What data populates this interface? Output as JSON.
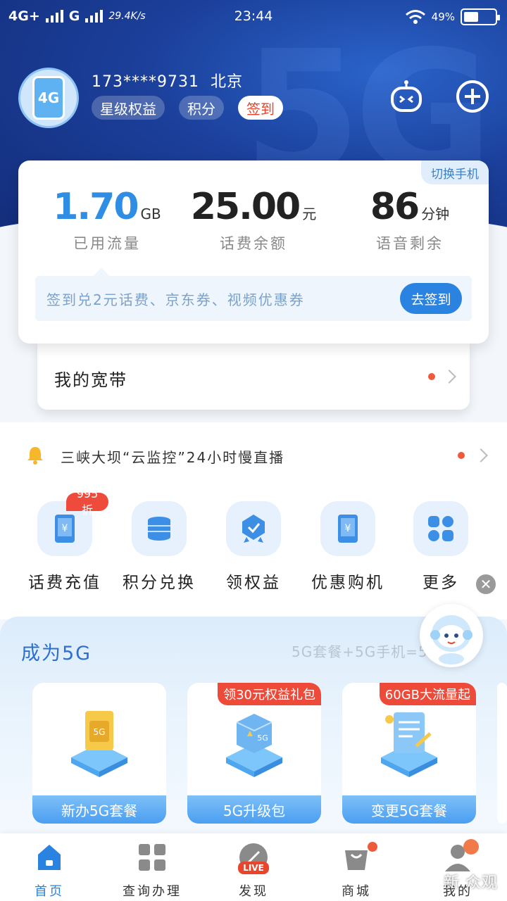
{
  "status_bar": {
    "network1": "4G+",
    "network2": "G",
    "speed": "29.4K/s",
    "time": "23:44",
    "battery": "49%"
  },
  "profile": {
    "avatar_text": "4G",
    "phone": "173****9731",
    "city": "北京",
    "chips": [
      "星级权益",
      "积分",
      "签到"
    ]
  },
  "stats": {
    "switch_label": "切换手机",
    "data_used": {
      "value": "1.70",
      "unit": "GB",
      "label": "已用流量"
    },
    "balance": {
      "value": "25.00",
      "unit": "元",
      "label": "话费余额"
    },
    "voice": {
      "value": "86",
      "unit": "分钟",
      "label": "语音剩余"
    },
    "promo_text": "签到兑2元话费、京东券、视频优惠券",
    "promo_button": "去签到"
  },
  "broadband": {
    "label": "我的宽带"
  },
  "notice": {
    "text": "三峡大坝“云监控”24小时慢直播"
  },
  "quick_actions": [
    {
      "label": "话费充值",
      "badge": "995折"
    },
    {
      "label": "积分兑换"
    },
    {
      "label": "领权益"
    },
    {
      "label": "优惠购机"
    },
    {
      "label": "更多"
    }
  ],
  "g5": {
    "title": "成为5G",
    "subtitle": "5G套餐+5G手机=5G",
    "cards": [
      {
        "label": "新办5G套餐",
        "tag": ""
      },
      {
        "label": "5G升级包",
        "tag": "领30元权益礼包"
      },
      {
        "label": "变更5G套餐",
        "tag": "60GB大流量起"
      }
    ]
  },
  "bottom_nav": [
    {
      "label": "首页",
      "live": ""
    },
    {
      "label": "查询办理",
      "live": ""
    },
    {
      "label": "发现",
      "live": "LIVE"
    },
    {
      "label": "商城",
      "live": ""
    },
    {
      "label": "我的",
      "live": ""
    }
  ],
  "watermark": "新 众观",
  "colors": {
    "brand_blue": "#2a83e0",
    "hero_blue": "#1b3f9a",
    "alert_red": "#ef4b3c"
  }
}
